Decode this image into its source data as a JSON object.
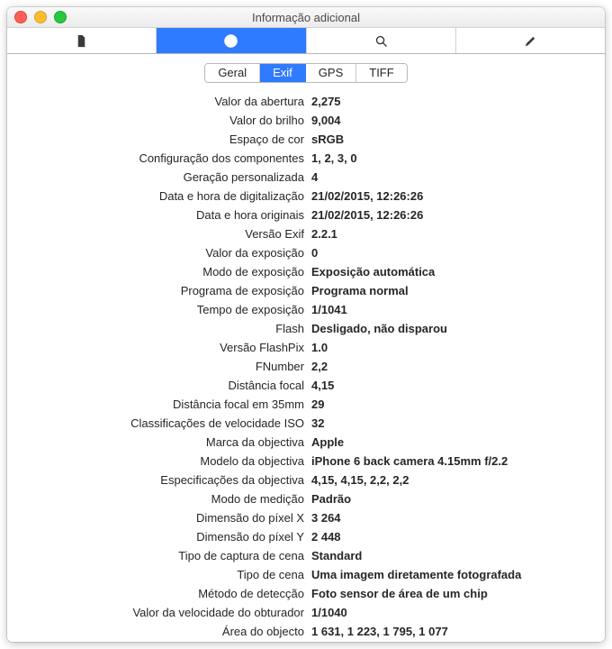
{
  "window": {
    "title": "Informação adicional"
  },
  "toolbar": {
    "items": [
      {
        "name": "doc-icon"
      },
      {
        "name": "info-icon",
        "active": true
      },
      {
        "name": "search-icon"
      },
      {
        "name": "edit-icon"
      }
    ]
  },
  "segments": [
    {
      "label": "Geral",
      "active": false
    },
    {
      "label": "Exif",
      "active": true
    },
    {
      "label": "GPS",
      "active": false
    },
    {
      "label": "TIFF",
      "active": false
    }
  ],
  "rows": [
    {
      "label": "Valor da abertura",
      "value": "2,275"
    },
    {
      "label": "Valor do brilho",
      "value": "9,004"
    },
    {
      "label": "Espaço de cor",
      "value": "sRGB"
    },
    {
      "label": "Configuração dos componentes",
      "value": "1, 2, 3, 0"
    },
    {
      "label": "Geração personalizada",
      "value": "4"
    },
    {
      "label": "Data e hora de digitalização",
      "value": "21/02/2015, 12:26:26"
    },
    {
      "label": "Data e hora originais",
      "value": "21/02/2015, 12:26:26"
    },
    {
      "label": "Versão Exif",
      "value": "2.2.1"
    },
    {
      "label": "Valor da exposição",
      "value": "0"
    },
    {
      "label": "Modo de exposição",
      "value": "Exposição automática"
    },
    {
      "label": "Programa de exposição",
      "value": "Programa normal"
    },
    {
      "label": "Tempo de exposição",
      "value": "1/1041"
    },
    {
      "label": "Flash",
      "value": "Desligado, não disparou"
    },
    {
      "label": "Versão FlashPix",
      "value": "1.0"
    },
    {
      "label": "FNumber",
      "value": "2,2"
    },
    {
      "label": "Distância focal",
      "value": "4,15"
    },
    {
      "label": "Distância focal em 35mm",
      "value": "29"
    },
    {
      "label": "Classificações de velocidade ISO",
      "value": "32"
    },
    {
      "label": "Marca da objectiva",
      "value": "Apple"
    },
    {
      "label": "Modelo da objectiva",
      "value": "iPhone 6 back camera 4.15mm f/2.2"
    },
    {
      "label": "Especificações da objectiva",
      "value": "4,15, 4,15, 2,2, 2,2"
    },
    {
      "label": "Modo de medição",
      "value": "Padrão"
    },
    {
      "label": "Dimensão do píxel X",
      "value": "3 264"
    },
    {
      "label": "Dimensão do píxel Y",
      "value": "2 448"
    },
    {
      "label": "Tipo de captura de cena",
      "value": "Standard"
    },
    {
      "label": "Tipo de cena",
      "value": "Uma imagem diretamente fotografada"
    },
    {
      "label": "Método de detecção",
      "value": "Foto sensor de área de um chip"
    },
    {
      "label": "Valor da velocidade do obturador",
      "value": "1/1040"
    },
    {
      "label": "Área do objecto",
      "value": "1 631, 1 223, 1 795, 1 077"
    }
  ]
}
